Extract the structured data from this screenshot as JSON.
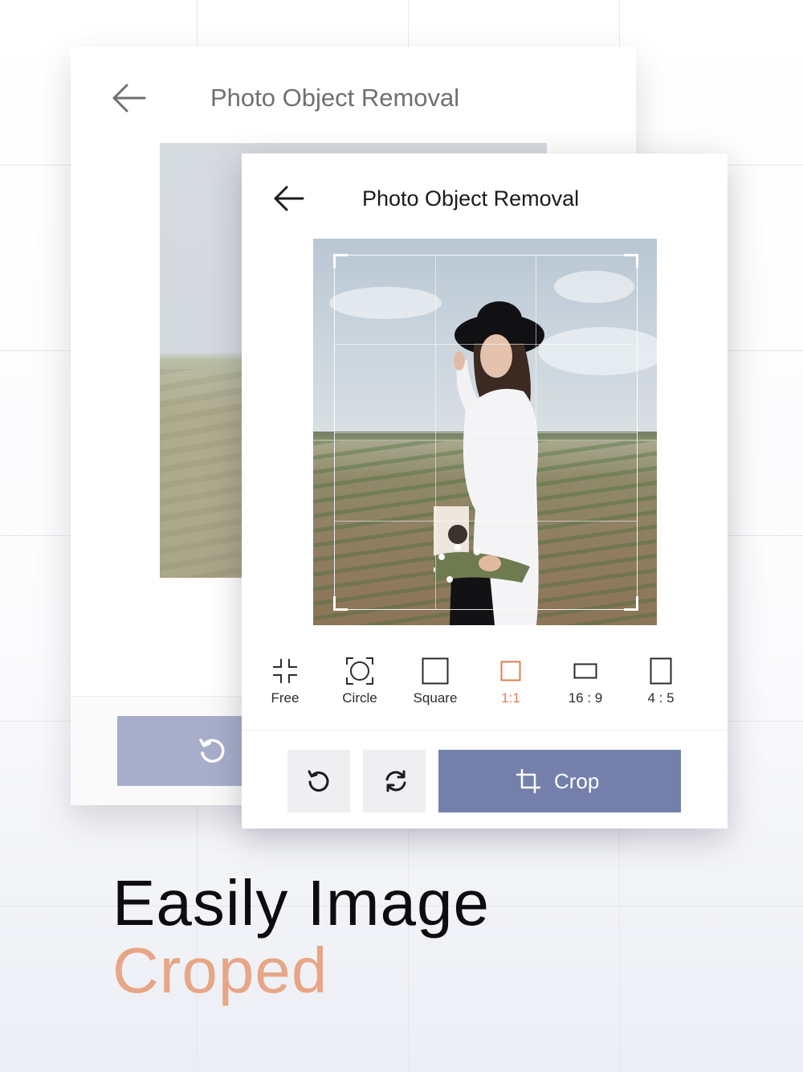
{
  "screen_title": "Photo Object Removal",
  "ratio_options": [
    {
      "label": "Free",
      "icon": "free-crop-icon"
    },
    {
      "label": "Circle",
      "icon": "circle-crop-icon"
    },
    {
      "label": "Square",
      "icon": "square-icon"
    },
    {
      "label": "1:1",
      "icon": "square-1x1-icon",
      "active": true
    },
    {
      "label": "16 : 9",
      "icon": "widescreen-icon"
    },
    {
      "label": "4 : 5",
      "icon": "portrait-icon"
    }
  ],
  "actions": {
    "rotate": "rotate-icon",
    "flip": "flip-icon",
    "crop_label": "Crop"
  },
  "headline": {
    "line1": "Easily Image",
    "line2": "Croped"
  },
  "colors": {
    "accent": "#e07d4f",
    "crop_button": "#7480ab",
    "headline_accent": "#e7a686"
  }
}
